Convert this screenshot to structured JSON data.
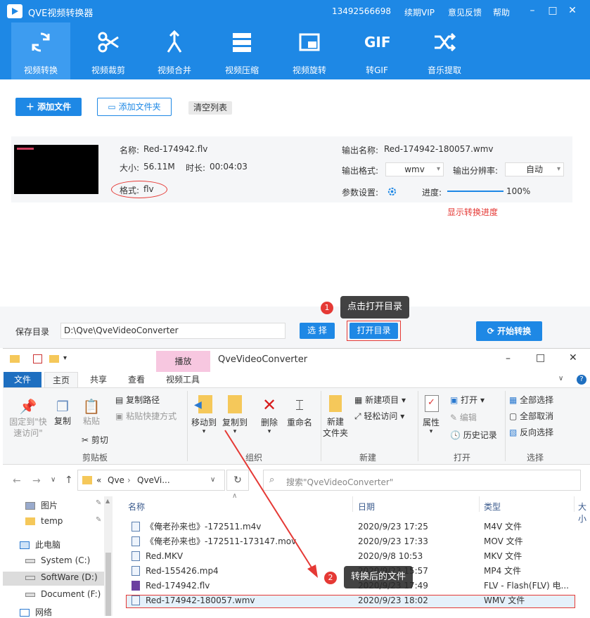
{
  "app": {
    "title": "QVE视频转换器",
    "phone": "13492566698",
    "vip": "续期VIP",
    "feedback": "意见反馈",
    "help": "帮助"
  },
  "toolbar": [
    {
      "label": "视频转换",
      "icon": "refresh-icon"
    },
    {
      "label": "视频裁剪",
      "icon": "scissors-icon"
    },
    {
      "label": "视频合并",
      "icon": "merge-icon"
    },
    {
      "label": "视频压缩",
      "icon": "compress-icon"
    },
    {
      "label": "视频旋转",
      "icon": "rotate-icon"
    },
    {
      "label": "转GIF",
      "icon": "gif-icon",
      "icon_text": "GIF"
    },
    {
      "label": "音乐提取",
      "icon": "shuffle-icon"
    }
  ],
  "actions": {
    "add_file": "添加文件",
    "add_folder": "添加文件夹",
    "clear_list": "清空列表"
  },
  "file": {
    "name_label": "名称:",
    "name": "Red-174942.flv",
    "size_label": "大小:",
    "size": "56.11M",
    "duration_label": "时长:",
    "duration": "00:04:03",
    "format_label": "格式:",
    "format": "flv",
    "out_name_label": "输出名称:",
    "out_name": "Red-174942-180057.wmv",
    "out_format_label": "输出格式:",
    "out_format": "wmv",
    "out_res_label": "输出分辨率:",
    "out_res": "自动",
    "params_label": "参数设置:",
    "progress_label": "进度:",
    "progress": 100,
    "progress_text": "100%",
    "progress_note": "显示转换进度"
  },
  "bottom": {
    "save_label": "保存目录",
    "save_path": "D:\\Qve\\QveVideoConverter",
    "choose": "选 择",
    "open_dir": "打开目录",
    "start": "开始转换"
  },
  "callouts": [
    {
      "num": "1",
      "text": "点击打开目录"
    },
    {
      "num": "2",
      "text": "转换后的文件"
    }
  ],
  "explorer": {
    "title": "QveVideoConverter",
    "context_tab": "播放",
    "tabs": [
      "文件",
      "主页",
      "共享",
      "查看",
      "视频工具"
    ],
    "ribbon": {
      "pin": "固定到\"快\n速访问\"",
      "copy": "复制",
      "paste": "粘贴",
      "copy_path": "复制路径",
      "paste_shortcut": "粘贴快捷方式",
      "cut": "剪切",
      "clipboard": "剪贴板",
      "move_to": "移动到",
      "copy_to": "复制到",
      "delete": "删除",
      "rename": "重命名",
      "organize": "组织",
      "new_folder": "新建\n文件夹",
      "new_item": "新建项目",
      "easy_access": "轻松访问",
      "new": "新建",
      "properties": "属性",
      "open": "打开",
      "edit": "编辑",
      "history": "历史记录",
      "open_grp": "打开",
      "select_all": "全部选择",
      "select_none": "全部取消",
      "invert": "反向选择",
      "select_grp": "选择"
    },
    "address": [
      "Qve",
      "QveVi..."
    ],
    "address_prefix": "«",
    "search_placeholder": "搜索\"QveVideoConverter\"",
    "nav": [
      {
        "label": "图片",
        "icon": "pictures-icon"
      },
      {
        "label": "temp",
        "icon": "folder-icon"
      },
      {
        "label": "此电脑",
        "icon": "computer-icon"
      },
      {
        "label": "System (C:)",
        "icon": "drive-icon"
      },
      {
        "label": "SoftWare (D:)",
        "icon": "drive-icon"
      },
      {
        "label": "Document (F:)",
        "icon": "drive-icon"
      },
      {
        "label": "网络",
        "icon": "network-icon"
      }
    ],
    "columns": [
      "名称",
      "日期",
      "类型",
      "大小"
    ],
    "files": [
      {
        "name": "《俺老孙来也》-172511.m4v",
        "date": "2020/9/23 17:25",
        "type": "M4V 文件"
      },
      {
        "name": "《俺老孙来也》-172511-173147.mov",
        "date": "2020/9/23 17:33",
        "type": "MOV 文件"
      },
      {
        "name": "Red.MKV",
        "date": "2020/9/8 10:53",
        "type": "MKV 文件"
      },
      {
        "name": "Red-155426.mp4",
        "date": "2020/9/23 15:57",
        "type": "MP4 文件"
      },
      {
        "name": "Red-174942.flv",
        "date": "2020/9/23 17:49",
        "type": "FLV - Flash(FLV) 电..."
      },
      {
        "name": "Red-174942-180057.wmv",
        "date": "2020/9/23 18:02",
        "type": "WMV 文件"
      }
    ]
  },
  "colors": {
    "brand": "#1e88e5",
    "annotation_red": "#e53935"
  }
}
